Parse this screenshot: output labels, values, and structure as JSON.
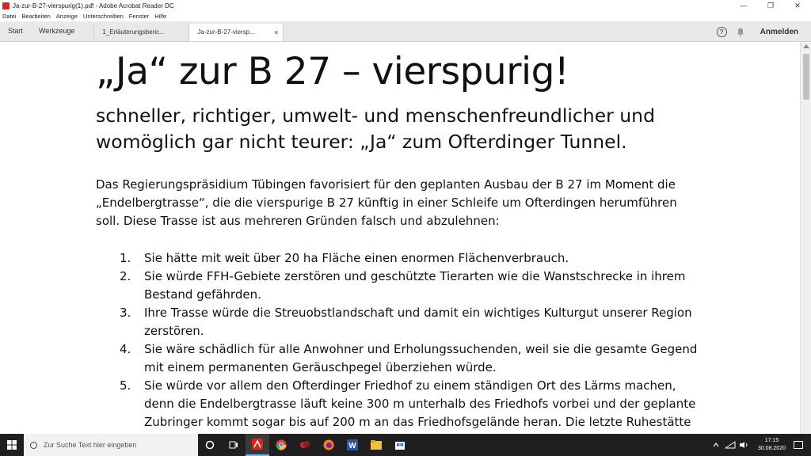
{
  "window": {
    "title": "Ja-zur-B-27-vierspurig(1).pdf - Adobe Acrobat Reader DC",
    "controls": [
      "—",
      "❐",
      "✕"
    ]
  },
  "menu": {
    "items": [
      "Datei",
      "Bearbeiten",
      "Anzeige",
      "Unterschreiben",
      "Fenster",
      "Hilfe"
    ]
  },
  "tabs": {
    "start": "Start",
    "tools": "Werkzeuge",
    "doc1": "1_Erläuterungsberic...",
    "doc2": "Ja-zur-B-27-viersp...",
    "close": "×",
    "help": "?",
    "signin": "Anmelden"
  },
  "document": {
    "title": "„Ja“ zur B 27 – vierspurig!",
    "subtitle": "schneller, richtiger, umwelt- und menschenfreundlicher und womöglich gar nicht teurer: „Ja“ zum Ofterdinger Tunnel.",
    "intro": "Das Regierungspräsidium Tübingen favorisiert für den geplanten Ausbau der B 27 im Moment die „Endelbergtrasse“, die die vierspurige B 27 künftig in einer Schleife um Ofterdingen herumführen soll. Diese Trasse ist aus mehreren Gründen falsch und abzulehnen:",
    "list": [
      {
        "num": "1.",
        "text": "Sie hätte mit weit über 20 ha Fläche einen enormen Flächenverbrauch."
      },
      {
        "num": "2.",
        "text": "Sie würde FFH-Gebiete zerstören und geschützte Tierarten wie die Wanstschrecke in ihrem Bestand gefährden."
      },
      {
        "num": "3.",
        "text": "Ihre Trasse würde die Streuobstlandschaft und damit ein wichtiges Kulturgut unserer Region zerstören."
      },
      {
        "num": "4.",
        "text": "Sie wäre schädlich für alle Anwohner und Erholungssuchenden, weil sie die gesamte Gegend mit einem permanenten Geräuschpegel überziehen würde."
      },
      {
        "num": "5.",
        "text": "Sie würde vor allem den Ofterdinger Friedhof zu einem ständigen Ort des Lärms machen, denn die Endelbergtrasse läuft keine 300 m unterhalb des Friedhofs vorbei und der geplante Zubringer kommt sogar bis auf 200 m an das Friedhofsgelände heran. Die letzte Ruhestätte der Ofterdinger Bürgerinnen und Bürger würde damit dauerhaft beschädigt und unruhig."
      }
    ]
  },
  "taskbar": {
    "search_placeholder": "Zur Suche Text hier eingeben",
    "time": "17:15",
    "date": "30.08.2020"
  }
}
